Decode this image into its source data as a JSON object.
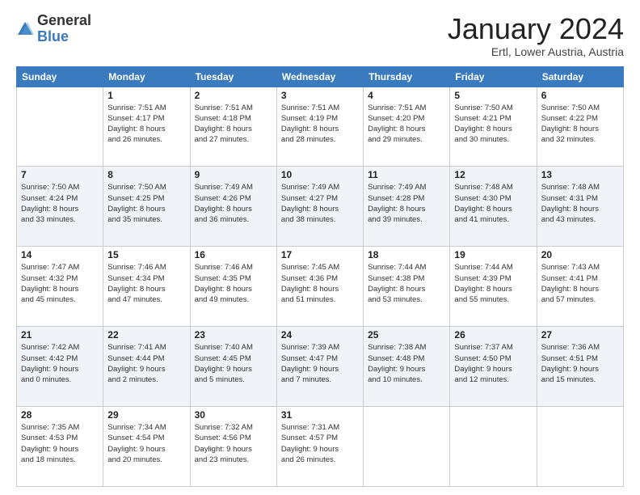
{
  "logo": {
    "general": "General",
    "blue": "Blue"
  },
  "header": {
    "month": "January 2024",
    "location": "Ertl, Lower Austria, Austria"
  },
  "columns": [
    "Sunday",
    "Monday",
    "Tuesday",
    "Wednesday",
    "Thursday",
    "Friday",
    "Saturday"
  ],
  "weeks": [
    [
      {
        "day": "",
        "info": ""
      },
      {
        "day": "1",
        "info": "Sunrise: 7:51 AM\nSunset: 4:17 PM\nDaylight: 8 hours\nand 26 minutes."
      },
      {
        "day": "2",
        "info": "Sunrise: 7:51 AM\nSunset: 4:18 PM\nDaylight: 8 hours\nand 27 minutes."
      },
      {
        "day": "3",
        "info": "Sunrise: 7:51 AM\nSunset: 4:19 PM\nDaylight: 8 hours\nand 28 minutes."
      },
      {
        "day": "4",
        "info": "Sunrise: 7:51 AM\nSunset: 4:20 PM\nDaylight: 8 hours\nand 29 minutes."
      },
      {
        "day": "5",
        "info": "Sunrise: 7:50 AM\nSunset: 4:21 PM\nDaylight: 8 hours\nand 30 minutes."
      },
      {
        "day": "6",
        "info": "Sunrise: 7:50 AM\nSunset: 4:22 PM\nDaylight: 8 hours\nand 32 minutes."
      }
    ],
    [
      {
        "day": "7",
        "info": "Sunrise: 7:50 AM\nSunset: 4:24 PM\nDaylight: 8 hours\nand 33 minutes."
      },
      {
        "day": "8",
        "info": "Sunrise: 7:50 AM\nSunset: 4:25 PM\nDaylight: 8 hours\nand 35 minutes."
      },
      {
        "day": "9",
        "info": "Sunrise: 7:49 AM\nSunset: 4:26 PM\nDaylight: 8 hours\nand 36 minutes."
      },
      {
        "day": "10",
        "info": "Sunrise: 7:49 AM\nSunset: 4:27 PM\nDaylight: 8 hours\nand 38 minutes."
      },
      {
        "day": "11",
        "info": "Sunrise: 7:49 AM\nSunset: 4:28 PM\nDaylight: 8 hours\nand 39 minutes."
      },
      {
        "day": "12",
        "info": "Sunrise: 7:48 AM\nSunset: 4:30 PM\nDaylight: 8 hours\nand 41 minutes."
      },
      {
        "day": "13",
        "info": "Sunrise: 7:48 AM\nSunset: 4:31 PM\nDaylight: 8 hours\nand 43 minutes."
      }
    ],
    [
      {
        "day": "14",
        "info": "Sunrise: 7:47 AM\nSunset: 4:32 PM\nDaylight: 8 hours\nand 45 minutes."
      },
      {
        "day": "15",
        "info": "Sunrise: 7:46 AM\nSunset: 4:34 PM\nDaylight: 8 hours\nand 47 minutes."
      },
      {
        "day": "16",
        "info": "Sunrise: 7:46 AM\nSunset: 4:35 PM\nDaylight: 8 hours\nand 49 minutes."
      },
      {
        "day": "17",
        "info": "Sunrise: 7:45 AM\nSunset: 4:36 PM\nDaylight: 8 hours\nand 51 minutes."
      },
      {
        "day": "18",
        "info": "Sunrise: 7:44 AM\nSunset: 4:38 PM\nDaylight: 8 hours\nand 53 minutes."
      },
      {
        "day": "19",
        "info": "Sunrise: 7:44 AM\nSunset: 4:39 PM\nDaylight: 8 hours\nand 55 minutes."
      },
      {
        "day": "20",
        "info": "Sunrise: 7:43 AM\nSunset: 4:41 PM\nDaylight: 8 hours\nand 57 minutes."
      }
    ],
    [
      {
        "day": "21",
        "info": "Sunrise: 7:42 AM\nSunset: 4:42 PM\nDaylight: 9 hours\nand 0 minutes."
      },
      {
        "day": "22",
        "info": "Sunrise: 7:41 AM\nSunset: 4:44 PM\nDaylight: 9 hours\nand 2 minutes."
      },
      {
        "day": "23",
        "info": "Sunrise: 7:40 AM\nSunset: 4:45 PM\nDaylight: 9 hours\nand 5 minutes."
      },
      {
        "day": "24",
        "info": "Sunrise: 7:39 AM\nSunset: 4:47 PM\nDaylight: 9 hours\nand 7 minutes."
      },
      {
        "day": "25",
        "info": "Sunrise: 7:38 AM\nSunset: 4:48 PM\nDaylight: 9 hours\nand 10 minutes."
      },
      {
        "day": "26",
        "info": "Sunrise: 7:37 AM\nSunset: 4:50 PM\nDaylight: 9 hours\nand 12 minutes."
      },
      {
        "day": "27",
        "info": "Sunrise: 7:36 AM\nSunset: 4:51 PM\nDaylight: 9 hours\nand 15 minutes."
      }
    ],
    [
      {
        "day": "28",
        "info": "Sunrise: 7:35 AM\nSunset: 4:53 PM\nDaylight: 9 hours\nand 18 minutes."
      },
      {
        "day": "29",
        "info": "Sunrise: 7:34 AM\nSunset: 4:54 PM\nDaylight: 9 hours\nand 20 minutes."
      },
      {
        "day": "30",
        "info": "Sunrise: 7:32 AM\nSunset: 4:56 PM\nDaylight: 9 hours\nand 23 minutes."
      },
      {
        "day": "31",
        "info": "Sunrise: 7:31 AM\nSunset: 4:57 PM\nDaylight: 9 hours\nand 26 minutes."
      },
      {
        "day": "",
        "info": ""
      },
      {
        "day": "",
        "info": ""
      },
      {
        "day": "",
        "info": ""
      }
    ]
  ]
}
